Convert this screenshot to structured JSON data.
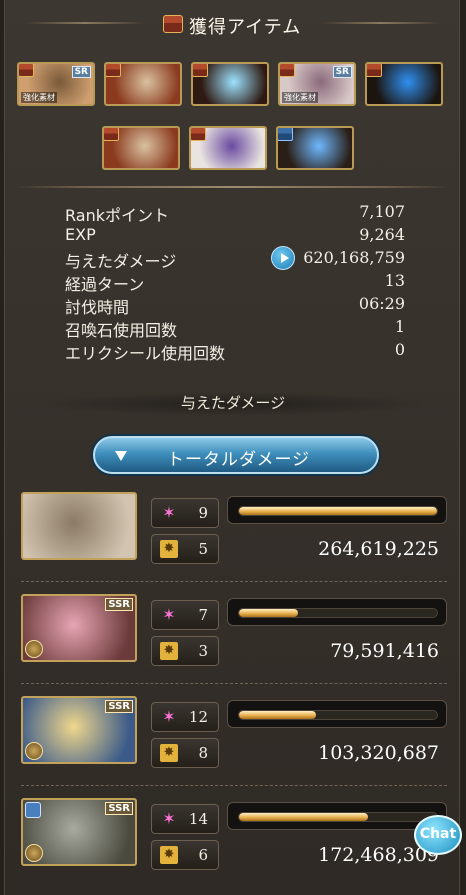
{
  "header": {
    "title": "獲得アイテム"
  },
  "items_row1": [
    {
      "icon": "character-portrait",
      "tag": "SR",
      "caption": "強化素材",
      "badge": "red",
      "colors": [
        "#cf9f6f",
        "#7a5a3a"
      ]
    },
    {
      "icon": "crystal-ball-portrait",
      "tag": "",
      "caption": "",
      "badge": "red",
      "colors": [
        "#8b3a1e",
        "#d9c2a1"
      ]
    },
    {
      "icon": "light-blue-weapon",
      "tag": "",
      "caption": "",
      "badge": "red",
      "colors": [
        "#2e1a12",
        "#9de2ff"
      ]
    },
    {
      "icon": "bow-weapon",
      "tag": "SR",
      "caption": "強化素材",
      "badge": "red",
      "colors": [
        "#d8c8c8",
        "#8a6a7a"
      ]
    },
    {
      "icon": "blue-flame-weapon",
      "tag": "",
      "caption": "",
      "badge": "red",
      "colors": [
        "#1c140e",
        "#2f8ff0"
      ]
    }
  ],
  "items_row2": [
    {
      "icon": "crystal-ball-portrait",
      "badge": "red",
      "colors": [
        "#8b3a1e",
        "#d9c2a1"
      ]
    },
    {
      "icon": "purple-gem-item",
      "badge": "red",
      "colors": [
        "#e9e4e0",
        "#6a4aa0"
      ]
    },
    {
      "icon": "blue-crystal-item",
      "badge": "blue",
      "colors": [
        "#2a1e16",
        "#6fb8ff"
      ]
    }
  ],
  "stats": [
    {
      "label": "Rankポイント",
      "value": "7,107"
    },
    {
      "label": "EXP",
      "value": "9,264"
    },
    {
      "label": "与えたダメージ",
      "value": "620,168,759",
      "play": true
    },
    {
      "label": "経過ターン",
      "value": "13"
    },
    {
      "label": "討伐時間",
      "value": "06:29"
    },
    {
      "label": "召喚石使用回数",
      "value": "1"
    },
    {
      "label": "エリクシール使用回数",
      "value": "0"
    }
  ],
  "damage_section": {
    "title": "与えたダメージ",
    "button_label": "トータルダメージ"
  },
  "characters": [
    {
      "name": "character-duo",
      "tag": "",
      "skill_count": "9",
      "ougi_count": "5",
      "damage": "264,619,225",
      "share": 1.0,
      "colors": [
        "#8a7a66",
        "#d2c4b0"
      ]
    },
    {
      "name": "character-pink-hair",
      "tag": "SSR",
      "skill_count": "7",
      "ougi_count": "3",
      "damage": "79,591,416",
      "share": 0.3,
      "colors": [
        "#e7a6b4",
        "#6b3a3a"
      ]
    },
    {
      "name": "character-blonde",
      "tag": "SSR",
      "skill_count": "12",
      "ougi_count": "8",
      "damage": "103,320,687",
      "share": 0.39,
      "colors": [
        "#f0d78c",
        "#3a5a8a"
      ]
    },
    {
      "name": "character-grey-hair",
      "tag": "SSR",
      "skill_count": "14",
      "ougi_count": "6",
      "damage": "172,468,309",
      "share": 0.65,
      "colors": [
        "#a8aaa0",
        "#4a4a3e"
      ]
    }
  ],
  "chat_button": {
    "label": "Chat"
  }
}
